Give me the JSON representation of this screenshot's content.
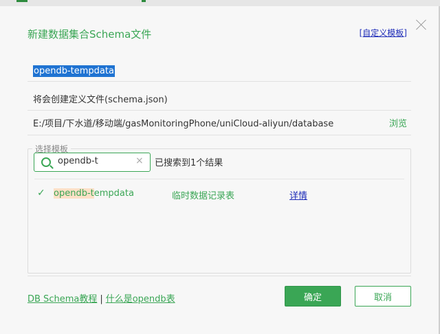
{
  "dialog": {
    "title": "新建数据集合Schema文件",
    "custom_template_link": "[自定义模板]",
    "close_icon": "close-icon"
  },
  "name_input": {
    "value": "opendb-tempdata"
  },
  "info": {
    "will_create": "将会创建定义文件(schema.json)",
    "path": "E:/项目/下水道/移动端/gasMonitoringPhone/uniCloud-aliyun/database",
    "browse": "浏览"
  },
  "template_group": {
    "legend": "选择模板",
    "search": {
      "value": "opendb-t",
      "clear": "×"
    },
    "result_count": "已搜索到1个结果",
    "results": [
      {
        "checked": true,
        "name_highlight": "opendb-t",
        "name_rest": "empdata",
        "description": "临时数据记录表",
        "detail_link": "详情"
      }
    ]
  },
  "footer": {
    "link1": "DB Schema教程",
    "separator": "|",
    "link2": "什么是opendb表",
    "ok": "确定",
    "cancel": "取消"
  },
  "colors": {
    "accent": "#3aa655",
    "selection": "#1f73d2",
    "link": "#1d2bb8",
    "highlight": "#fde0c7"
  }
}
